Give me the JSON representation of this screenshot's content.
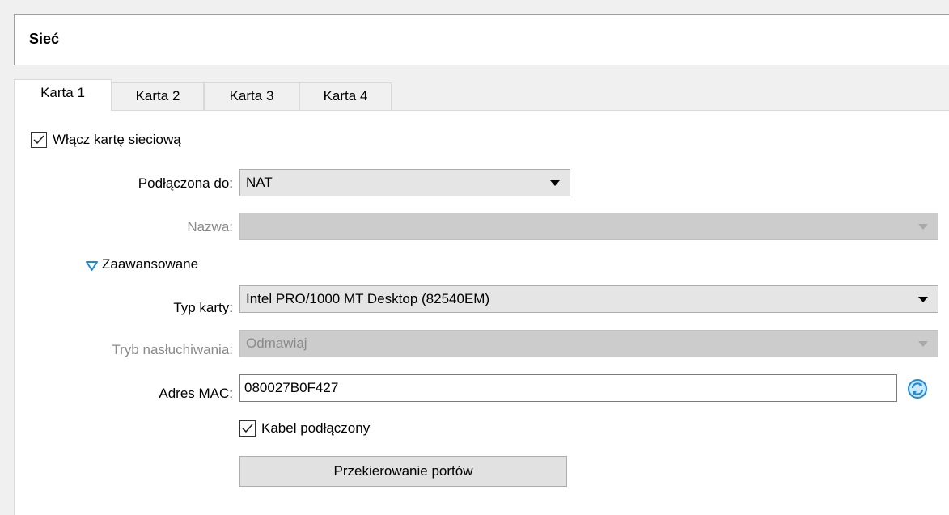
{
  "section": {
    "title": "Sieć"
  },
  "tabs": [
    {
      "label": "Karta 1",
      "active": true
    },
    {
      "label": "Karta 2",
      "active": false
    },
    {
      "label": "Karta 3",
      "active": false
    },
    {
      "label": "Karta 4",
      "active": false
    }
  ],
  "adapter": {
    "enable_label": "Włącz kartę sieciową",
    "enable_checked": true,
    "attached_to_label": "Podłączona do:",
    "attached_to_value": "NAT",
    "name_label": "Nazwa:",
    "name_value": "",
    "advanced_label": "Zaawansowane",
    "advanced_expanded": true,
    "adapter_type_label": "Typ karty:",
    "adapter_type_value": "Intel PRO/1000 MT Desktop (82540EM)",
    "promiscuous_label": "Tryb nasłuchiwania:",
    "promiscuous_value": "Odmawiaj",
    "mac_label": "Adres MAC:",
    "mac_value": "080027B0F427",
    "cable_label": "Kabel podłączony",
    "cable_checked": true,
    "port_forwarding_label": "Przekierowanie portów"
  },
  "colors": {
    "accent_blue": "#1e8ad6",
    "disabled_text": "#8a8a8a",
    "disabled_bg": "#cccccc"
  },
  "icons": {
    "refresh_mac": "refresh-icon",
    "expand": "triangle-down-icon",
    "check": "checkmark-icon"
  }
}
